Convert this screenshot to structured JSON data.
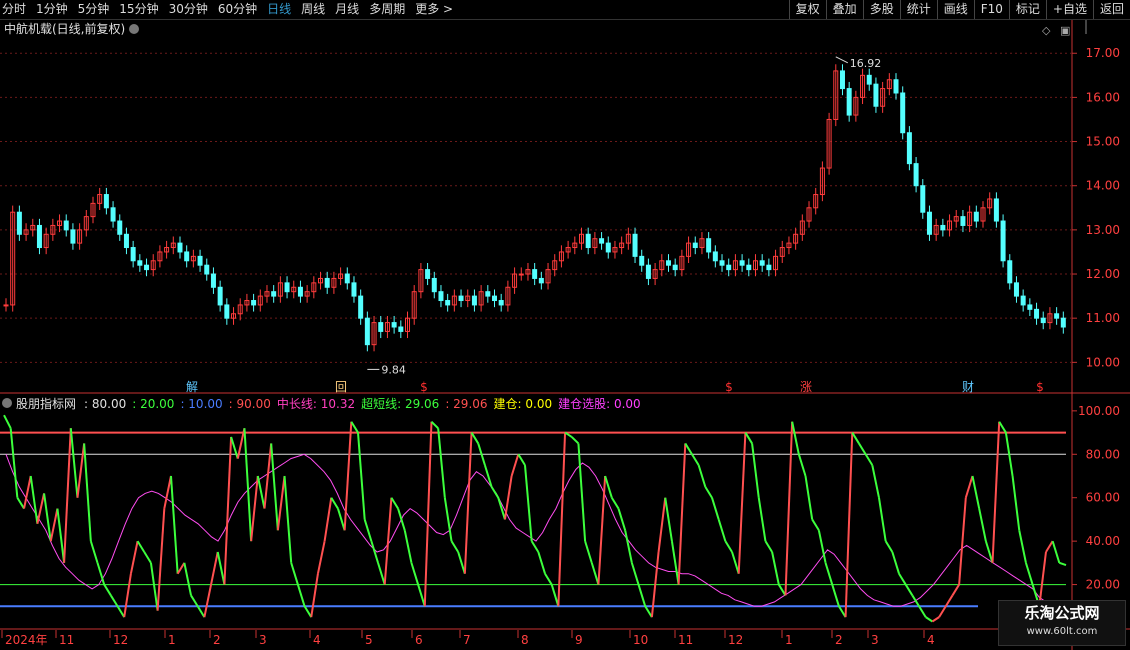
{
  "toolbar": {
    "left": [
      "分时",
      "1分钟",
      "5分钟",
      "15分钟",
      "30分钟",
      "60分钟",
      "日线",
      "周线",
      "月线",
      "多周期",
      "更多 >"
    ],
    "active_index": 6,
    "right": [
      "复权",
      "叠加",
      "多股",
      "统计",
      "画线",
      "F10",
      "标记",
      "+自选",
      "返回"
    ]
  },
  "price_title": "中航机载(日线,前复权)",
  "indicator_title": "股朋指标网",
  "indicator_legend": [
    {
      "text": ": 80.00",
      "color": "#e0e0e0"
    },
    {
      "text": ": 20.00",
      "color": "#3cff3c"
    },
    {
      "text": ": 10.00",
      "color": "#4a7dff"
    },
    {
      "text": ": 90.00",
      "color": "#ff5050"
    },
    {
      "text": "中长线: 10.32",
      "color": "#ff40c0"
    },
    {
      "text": "超短线: 29.06",
      "color": "#3cff3c"
    },
    {
      "text": ": 29.06",
      "color": "#ff5050"
    },
    {
      "text": "建仓: 0.00",
      "color": "#ffff00"
    },
    {
      "text": "建仓选股: 0.00",
      "color": "#ff40ff"
    }
  ],
  "markers": [
    {
      "label": "解",
      "color": "#5fc8ff"
    },
    {
      "label": "回",
      "color": "#ffd080"
    },
    {
      "label": "$",
      "color": "#ff3030"
    },
    {
      "label": "$",
      "color": "#ff3030"
    },
    {
      "label": "涨",
      "color": "#ff4040"
    },
    {
      "label": "财",
      "color": "#5fc8ff"
    },
    {
      "label": "$",
      "color": "#ff3030"
    }
  ],
  "high_label": "16.92",
  "low_label": "9.84",
  "time_axis": [
    "2024年",
    "11",
    "12",
    "1",
    "2",
    "3",
    "4",
    "5",
    "6",
    "7",
    "8",
    "9",
    "10",
    "11",
    "12",
    "1",
    "2",
    "3",
    "4"
  ],
  "watermark": {
    "line1": "乐淘公式网",
    "line2": "www.60lt.com"
  },
  "colors": {
    "up": "#ff3c3c",
    "down": "#54ffff",
    "grid": "#6b1a1a",
    "axis": "#c83232",
    "pink": "#ff4df0",
    "green": "#3cff3c",
    "blue": "#2060ff",
    "red_line": "#ff5050"
  },
  "chart_data": [
    {
      "type": "candlestick",
      "title": "中航机载(日线,前复权)",
      "y_ticks": [
        10.0,
        11.0,
        12.0,
        13.0,
        14.0,
        15.0,
        16.0,
        17.0
      ],
      "ylim": [
        9.6,
        17.3
      ],
      "close": [
        11.3,
        13.4,
        12.9,
        13.0,
        13.1,
        12.6,
        12.9,
        13.1,
        13.2,
        13.0,
        12.7,
        13.0,
        13.3,
        13.6,
        13.8,
        13.5,
        13.2,
        12.9,
        12.6,
        12.3,
        12.2,
        12.1,
        12.3,
        12.5,
        12.6,
        12.7,
        12.5,
        12.3,
        12.4,
        12.2,
        12.0,
        11.7,
        11.3,
        11.0,
        11.1,
        11.3,
        11.4,
        11.3,
        11.5,
        11.6,
        11.5,
        11.8,
        11.6,
        11.7,
        11.5,
        11.6,
        11.8,
        11.9,
        11.7,
        11.9,
        12.0,
        11.8,
        11.5,
        11.0,
        10.4,
        10.9,
        10.7,
        10.9,
        10.8,
        10.7,
        11.0,
        11.6,
        12.1,
        11.9,
        11.6,
        11.4,
        11.3,
        11.5,
        11.4,
        11.5,
        11.3,
        11.6,
        11.5,
        11.4,
        11.3,
        11.7,
        12.0,
        12.0,
        12.1,
        11.9,
        11.8,
        12.1,
        12.3,
        12.5,
        12.6,
        12.7,
        12.9,
        12.6,
        12.8,
        12.7,
        12.5,
        12.6,
        12.7,
        12.9,
        12.4,
        12.2,
        11.9,
        12.1,
        12.3,
        12.2,
        12.1,
        12.4,
        12.7,
        12.6,
        12.8,
        12.5,
        12.3,
        12.2,
        12.1,
        12.3,
        12.2,
        12.1,
        12.3,
        12.2,
        12.1,
        12.4,
        12.6,
        12.7,
        12.9,
        13.2,
        13.5,
        13.8,
        14.4,
        15.5,
        16.6,
        16.2,
        15.6,
        16.0,
        16.5,
        16.3,
        15.8,
        16.2,
        16.4,
        16.1,
        15.2,
        14.5,
        14.0,
        13.4,
        12.9,
        13.1,
        13.0,
        13.2,
        13.3,
        13.1,
        13.4,
        13.2,
        13.5,
        13.7,
        13.2,
        12.3,
        11.8,
        11.5,
        11.3,
        11.2,
        11.0,
        10.9,
        11.1,
        11.0,
        10.8
      ],
      "high_marker": 16.92,
      "low_marker": 9.84
    },
    {
      "type": "line",
      "title": "股朋指标网",
      "y_ticks": [
        20.0,
        40.0,
        60.0,
        80.0,
        100.0
      ],
      "ylim": [
        0,
        105
      ],
      "hlines": [
        {
          "value": 80,
          "color": "#e0e0e0"
        },
        {
          "value": 20,
          "color": "#3cff3c"
        },
        {
          "value": 10,
          "color": "#4a7dff"
        },
        {
          "value": 90,
          "color": "#ff5050"
        }
      ],
      "series": [
        {
          "name": "中长线",
          "color": "#ff40c0",
          "values": [
            80,
            72,
            65,
            60,
            55,
            50,
            45,
            38,
            32,
            28,
            25,
            22,
            20,
            18,
            20,
            25,
            32,
            40,
            48,
            55,
            60,
            62,
            63,
            62,
            60,
            58,
            55,
            52,
            50,
            48,
            45,
            42,
            40,
            45,
            52,
            58,
            62,
            65,
            68,
            70,
            72,
            74,
            76,
            78,
            79,
            80,
            78,
            75,
            72,
            68,
            62,
            55,
            50,
            46,
            42,
            38,
            35,
            36,
            40,
            46,
            52,
            55,
            53,
            50,
            47,
            44,
            43,
            45,
            52,
            60,
            68,
            72,
            70,
            66,
            62,
            56,
            50,
            46,
            44,
            42,
            40,
            44,
            50,
            55,
            62,
            68,
            73,
            76,
            74,
            70,
            64,
            57,
            50,
            44,
            40,
            36,
            33,
            30,
            28,
            27,
            26,
            26,
            25,
            25,
            24,
            22,
            20,
            18,
            16,
            15,
            13,
            12,
            11,
            10,
            10,
            11,
            12,
            14,
            16,
            18,
            20,
            24,
            28,
            32,
            36,
            34,
            30,
            26,
            22,
            18,
            15,
            13,
            12,
            11,
            10,
            10,
            11,
            12,
            14,
            17,
            20,
            24,
            28,
            32,
            36,
            38,
            36,
            34,
            32,
            30,
            28,
            26,
            24,
            22,
            20,
            18,
            14,
            12,
            11,
            10,
            10
          ]
        },
        {
          "name": "超短线",
          "color": "#3cff3c",
          "values": [
            98,
            92,
            60,
            55,
            70,
            48,
            62,
            40,
            55,
            30,
            92,
            60,
            85,
            40,
            30,
            20,
            15,
            10,
            5,
            25,
            40,
            35,
            30,
            8,
            55,
            70,
            25,
            30,
            15,
            10,
            5,
            20,
            35,
            20,
            88,
            78,
            92,
            40,
            70,
            55,
            85,
            45,
            70,
            30,
            20,
            10,
            5,
            25,
            40,
            60,
            55,
            45,
            95,
            90,
            50,
            40,
            30,
            20,
            60,
            55,
            45,
            30,
            20,
            10,
            95,
            92,
            60,
            40,
            35,
            25,
            90,
            85,
            75,
            65,
            60,
            50,
            70,
            80,
            75,
            40,
            35,
            25,
            20,
            10,
            90,
            88,
            85,
            40,
            30,
            20,
            70,
            60,
            55,
            45,
            30,
            20,
            10,
            5,
            35,
            60,
            40,
            20,
            85,
            80,
            75,
            65,
            60,
            50,
            40,
            35,
            25,
            90,
            85,
            60,
            40,
            35,
            20,
            15,
            95,
            80,
            70,
            50,
            45,
            30,
            20,
            10,
            5,
            90,
            85,
            80,
            75,
            60,
            40,
            35,
            25,
            20,
            15,
            10,
            5,
            3,
            5,
            10,
            15,
            20,
            60,
            70,
            55,
            40,
            30,
            95,
            90,
            70,
            45,
            30,
            20,
            10,
            35,
            40,
            30,
            29
          ]
        },
        {
          "name": "超短线-red",
          "color": "#ff5050",
          "values": []
        }
      ]
    }
  ]
}
